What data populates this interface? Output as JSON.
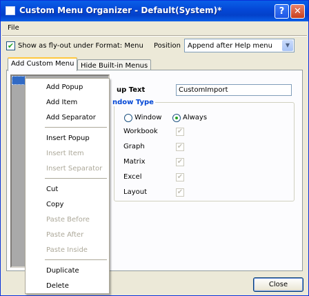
{
  "window": {
    "title": "Custom Menu Organizer - Default(System)*"
  },
  "titlebar_buttons": {
    "help": "?",
    "close": "✕"
  },
  "menubar": {
    "file": "File"
  },
  "options": {
    "flyout_label": "Show as fly-out under Format: Menu",
    "flyout_checked": true,
    "position_label": "Position",
    "position_value": "Append after Help menu"
  },
  "tabs": [
    {
      "label": "Add Custom Menu",
      "active": true
    },
    {
      "label": "Hide Built-in Menus",
      "active": false
    }
  ],
  "tree": {
    "selected_item": ""
  },
  "form": {
    "popup_text_label": "up Text",
    "popup_text_value": "CustomImport",
    "window_type_title": "ndow Type",
    "radio_window": "Window",
    "radio_always": "Always",
    "radio_selected": "Always",
    "window_types": [
      "Workbook",
      "Graph",
      "Matrix",
      "Excel",
      "Layout"
    ]
  },
  "context_menu": {
    "items": [
      {
        "label": "Add Popup",
        "enabled": true
      },
      {
        "label": "Add Item",
        "enabled": true
      },
      {
        "label": "Add Separator",
        "enabled": true
      },
      {
        "label": "Insert Popup",
        "enabled": true
      },
      {
        "label": "Insert Item",
        "enabled": false
      },
      {
        "label": "Insert Separator",
        "enabled": false
      },
      {
        "label": "Cut",
        "enabled": true
      },
      {
        "label": "Copy",
        "enabled": true
      },
      {
        "label": "Paste Before",
        "enabled": false
      },
      {
        "label": "Paste After",
        "enabled": false
      },
      {
        "label": "Paste Inside",
        "enabled": false
      },
      {
        "label": "Duplicate",
        "enabled": true
      },
      {
        "label": "Delete",
        "enabled": true
      }
    ]
  },
  "buttons": {
    "close": "Close"
  },
  "colors": {
    "titlebar": "#0a5fe8",
    "dialog_bg": "#ece9d8",
    "group_title": "#0046d5",
    "disabled_text": "#aca899",
    "selection": "#316ac5"
  }
}
